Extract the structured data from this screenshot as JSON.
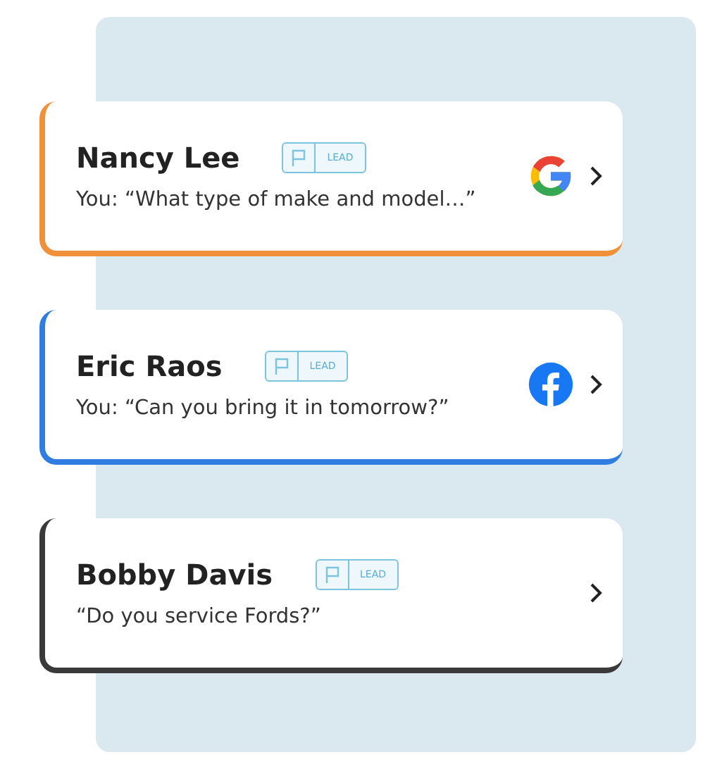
{
  "conversations": [
    {
      "name": "Nancy Lee",
      "tag": "LEAD",
      "message": "You: “What type of make and model…”",
      "color": "#f0913a",
      "kind": "google"
    },
    {
      "name": "Eric Raos",
      "tag": "LEAD",
      "message": "You: “Can you bring it in tomorrow?”",
      "color": "#2f7de1",
      "kind": "facebook"
    },
    {
      "name": "Bobby Davis",
      "tag": "LEAD",
      "message": "“Do you service Fords?”",
      "color": "#3a3a3a",
      "kind": "plain"
    }
  ]
}
